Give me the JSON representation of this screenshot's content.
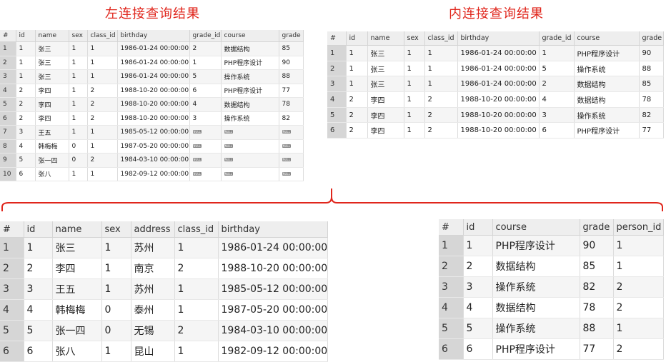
{
  "titles": {
    "left": "左连接查询结果",
    "inner": "内连接查询结果"
  },
  "left_join": {
    "headers": [
      "#",
      "id",
      "name",
      "sex",
      "class_id",
      "birthday",
      "grade_id",
      "course",
      "grade"
    ],
    "rows": [
      [
        "1",
        "1",
        "张三",
        "1",
        "1",
        "1986-01-24 00:00:00",
        "2",
        "数据结构",
        "85"
      ],
      [
        "2",
        "1",
        "张三",
        "1",
        "1",
        "1986-01-24 00:00:00",
        "1",
        "PHP程序设计",
        "90"
      ],
      [
        "3",
        "1",
        "张三",
        "1",
        "1",
        "1986-01-24 00:00:00",
        "5",
        "操作系统",
        "88"
      ],
      [
        "4",
        "2",
        "李四",
        "1",
        "2",
        "1988-10-20 00:00:00",
        "6",
        "PHP程序设计",
        "77"
      ],
      [
        "5",
        "2",
        "李四",
        "1",
        "2",
        "1988-10-20 00:00:00",
        "4",
        "数据结构",
        "78"
      ],
      [
        "6",
        "2",
        "李四",
        "1",
        "2",
        "1988-10-20 00:00:00",
        "3",
        "操作系统",
        "82"
      ],
      [
        "7",
        "3",
        "王五",
        "1",
        "1",
        "1985-05-12 00:00:00",
        "NULL",
        "NULL",
        "NULL"
      ],
      [
        "8",
        "4",
        "韩梅梅",
        "0",
        "1",
        "1987-05-20 00:00:00",
        "NULL",
        "NULL",
        "NULL"
      ],
      [
        "9",
        "5",
        "张一四",
        "0",
        "2",
        "1984-03-10 00:00:00",
        "NULL",
        "NULL",
        "NULL"
      ],
      [
        "10",
        "6",
        "张八",
        "1",
        "1",
        "1982-09-12 00:00:00",
        "NULL",
        "NULL",
        "NULL"
      ]
    ]
  },
  "inner_join": {
    "headers": [
      "#",
      "id",
      "name",
      "sex",
      "class_id",
      "birthday",
      "grade_id",
      "course",
      "grade"
    ],
    "rows": [
      [
        "1",
        "1",
        "张三",
        "1",
        "1",
        "1986-01-24 00:00:00",
        "1",
        "PHP程序设计",
        "90"
      ],
      [
        "2",
        "1",
        "张三",
        "1",
        "1",
        "1986-01-24 00:00:00",
        "5",
        "操作系统",
        "88"
      ],
      [
        "3",
        "1",
        "张三",
        "1",
        "1",
        "1986-01-24 00:00:00",
        "2",
        "数据结构",
        "85"
      ],
      [
        "4",
        "2",
        "李四",
        "1",
        "2",
        "1988-10-20 00:00:00",
        "4",
        "数据结构",
        "78"
      ],
      [
        "5",
        "2",
        "李四",
        "1",
        "2",
        "1988-10-20 00:00:00",
        "3",
        "操作系统",
        "82"
      ],
      [
        "6",
        "2",
        "李四",
        "1",
        "2",
        "1988-10-20 00:00:00",
        "6",
        "PHP程序设计",
        "77"
      ]
    ]
  },
  "persons": {
    "headers": [
      "#",
      "id",
      "name",
      "sex",
      "address",
      "class_id",
      "birthday"
    ],
    "rows": [
      [
        "1",
        "1",
        "张三",
        "1",
        "苏州",
        "1",
        "1986-01-24 00:00:00"
      ],
      [
        "2",
        "2",
        "李四",
        "1",
        "南京",
        "2",
        "1988-10-20 00:00:00"
      ],
      [
        "3",
        "3",
        "王五",
        "1",
        "苏州",
        "1",
        "1985-05-12 00:00:00"
      ],
      [
        "4",
        "4",
        "韩梅梅",
        "0",
        "泰州",
        "1",
        "1987-05-20 00:00:00"
      ],
      [
        "5",
        "5",
        "张一四",
        "0",
        "无锡",
        "2",
        "1984-03-10 00:00:00"
      ],
      [
        "6",
        "6",
        "张八",
        "1",
        "昆山",
        "1",
        "1982-09-12 00:00:00"
      ]
    ]
  },
  "grades": {
    "headers": [
      "#",
      "id",
      "course",
      "grade",
      "person_id"
    ],
    "rows": [
      [
        "1",
        "1",
        "PHP程序设计",
        "90",
        "1"
      ],
      [
        "2",
        "2",
        "数据结构",
        "85",
        "1"
      ],
      [
        "3",
        "3",
        "操作系统",
        "82",
        "2"
      ],
      [
        "4",
        "4",
        "数据结构",
        "78",
        "2"
      ],
      [
        "5",
        "5",
        "操作系统",
        "88",
        "1"
      ],
      [
        "6",
        "6",
        "PHP程序设计",
        "77",
        "2"
      ]
    ]
  },
  "colors": {
    "title": "#e0261c",
    "brace": "#e0261c",
    "header_bg": "#eeeeee",
    "rownum_bg": "#d6d6d6"
  }
}
